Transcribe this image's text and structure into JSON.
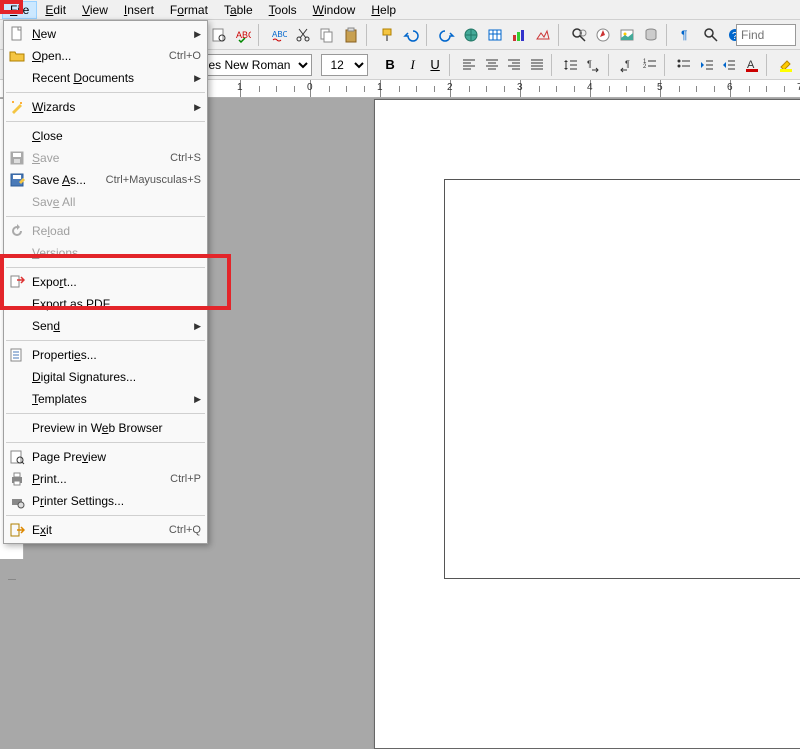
{
  "menubar": [
    {
      "label": "File",
      "u": 0,
      "active": true
    },
    {
      "label": "Edit",
      "u": 0
    },
    {
      "label": "View",
      "u": 0
    },
    {
      "label": "Insert",
      "u": 0
    },
    {
      "label": "Format",
      "u": 1
    },
    {
      "label": "Table",
      "u": 1
    },
    {
      "label": "Tools",
      "u": 0
    },
    {
      "label": "Window",
      "u": 0
    },
    {
      "label": "Help",
      "u": 0
    }
  ],
  "toolbar1_icons": [
    "new-doc",
    "open-doc",
    "save-doc",
    "email",
    "edit-doc",
    "pdf",
    "print",
    "preview",
    "spellcheck",
    "autospell",
    "cut",
    "copy",
    "paste",
    "format-paint",
    "undo",
    "redo",
    "hyperlink",
    "table",
    "chart",
    "show-draw",
    "find-replace",
    "navigator",
    "gallery",
    "data-sources",
    "nonprint",
    "zoom",
    "help",
    "whatsthis",
    "extension"
  ],
  "find_placeholder": "Find",
  "toolbar2": {
    "font_name": "Times New Roman",
    "font_size": "12",
    "buttons": [
      "bold",
      "italic",
      "underline",
      "align-left",
      "align-center",
      "align-right",
      "justify",
      "line-spacing",
      "ltr",
      "rtl",
      "numbering",
      "bullets",
      "indent-less",
      "indent-more",
      "font-color",
      "highlight"
    ]
  },
  "ruler": {
    "start": -1,
    "end": 10
  },
  "dropdown": [
    {
      "type": "item",
      "label": "New",
      "u": 0,
      "icon": "new",
      "sub": true
    },
    {
      "type": "item",
      "label": "Open...",
      "u": 0,
      "icon": "open",
      "shortcut": "Ctrl+O"
    },
    {
      "type": "item",
      "label": "Recent Documents",
      "u": 7,
      "sub": true
    },
    {
      "type": "sep"
    },
    {
      "type": "item",
      "label": "Wizards",
      "u": 0,
      "icon": "wizard",
      "sub": true
    },
    {
      "type": "sep"
    },
    {
      "type": "item",
      "label": "Close",
      "u": 0
    },
    {
      "type": "item",
      "label": "Save",
      "u": 0,
      "icon": "save-dis",
      "shortcut": "Ctrl+S",
      "disabled": true
    },
    {
      "type": "item",
      "label": "Save As...",
      "u": 5,
      "icon": "saveas",
      "shortcut": "Ctrl+Mayusculas+S"
    },
    {
      "type": "item",
      "label": "Save All",
      "u": 3,
      "disabled": true
    },
    {
      "type": "sep"
    },
    {
      "type": "item",
      "label": "Reload",
      "u": 2,
      "icon": "reload-dis",
      "disabled": true
    },
    {
      "type": "item",
      "label": "Versions...",
      "u": 0,
      "disabled": true
    },
    {
      "type": "sep"
    },
    {
      "type": "item",
      "label": "Export...",
      "u": 4,
      "icon": "export"
    },
    {
      "type": "item",
      "label": "Export as PDF...",
      "u": 10
    },
    {
      "type": "item",
      "label": "Send",
      "u": 3,
      "sub": true
    },
    {
      "type": "sep"
    },
    {
      "type": "item",
      "label": "Properties...",
      "u": 8,
      "icon": "props"
    },
    {
      "type": "item",
      "label": "Digital Signatures...",
      "u": 0
    },
    {
      "type": "item",
      "label": "Templates",
      "u": 0,
      "sub": true
    },
    {
      "type": "sep"
    },
    {
      "type": "item",
      "label": "Preview in Web Browser",
      "u": 12
    },
    {
      "type": "sep"
    },
    {
      "type": "item",
      "label": "Page Preview",
      "u": 8,
      "icon": "pagepreview"
    },
    {
      "type": "item",
      "label": "Print...",
      "u": 0,
      "icon": "print",
      "shortcut": "Ctrl+P"
    },
    {
      "type": "item",
      "label": "Printer Settings...",
      "u": 1,
      "icon": "printset"
    },
    {
      "type": "sep"
    },
    {
      "type": "item",
      "label": "Exit",
      "u": 1,
      "icon": "exit",
      "shortcut": "Ctrl+Q"
    }
  ]
}
